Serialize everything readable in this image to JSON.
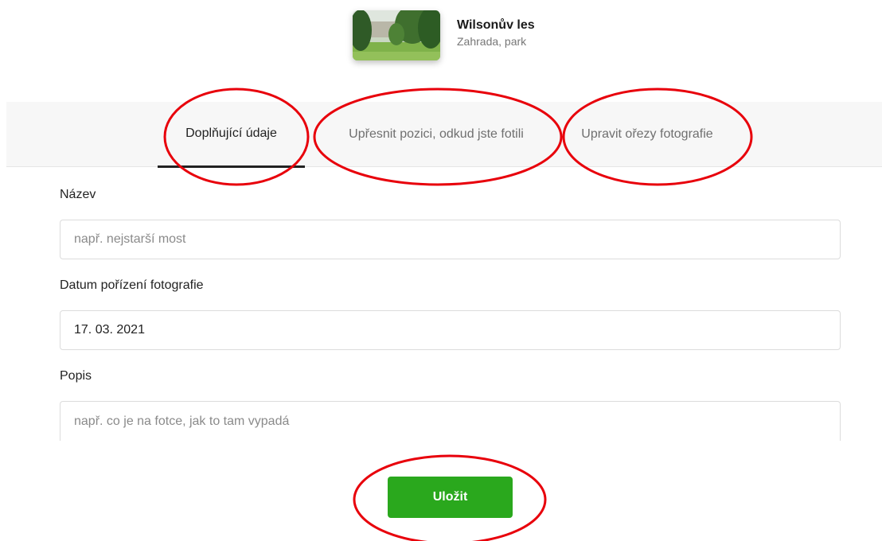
{
  "place": {
    "name": "Wilsonův les",
    "type": "Zahrada, park",
    "thumbnail_icon": "park-photo-thumbnail"
  },
  "tabs": [
    {
      "label": "Doplňující údaje",
      "active": true
    },
    {
      "label": "Upřesnit pozici, odkud jste fotili",
      "active": false
    },
    {
      "label": "Upravit ořezy fotografie",
      "active": false
    }
  ],
  "form": {
    "name_label": "Název",
    "name_placeholder": "např. nejstarší most",
    "date_label": "Datum pořízení fotografie",
    "date_value": "17. 03. 2021",
    "description_label": "Popis",
    "description_placeholder": "např. co je na fotce, jak to tam vypadá"
  },
  "save_label": "Uložit",
  "colors": {
    "accent_green": "#2aa81d",
    "annotation_red": "#e8000b",
    "tab_bar_bg": "#f7f7f7"
  }
}
